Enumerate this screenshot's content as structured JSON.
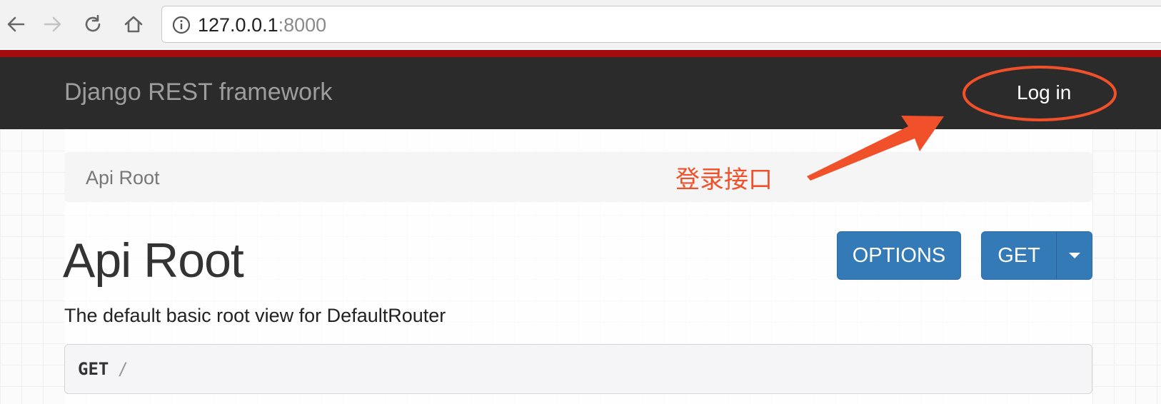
{
  "browser": {
    "url_host": "127.0.0.1",
    "url_port": ":8000"
  },
  "navbar": {
    "brand": "Django REST framework",
    "login_label": "Log in"
  },
  "breadcrumb": {
    "item": "Api Root"
  },
  "annotation": {
    "text": "登录接口",
    "color": "#f0502a"
  },
  "page": {
    "title": "Api Root",
    "description": "The default basic root view for DefaultRouter"
  },
  "buttons": {
    "options_label": "OPTIONS",
    "get_label": "GET"
  },
  "request": {
    "method": "GET",
    "path": "/"
  },
  "colors": {
    "navbar": "#2b2b2b",
    "stripe": "#a30d0d",
    "button": "#337ab7"
  }
}
